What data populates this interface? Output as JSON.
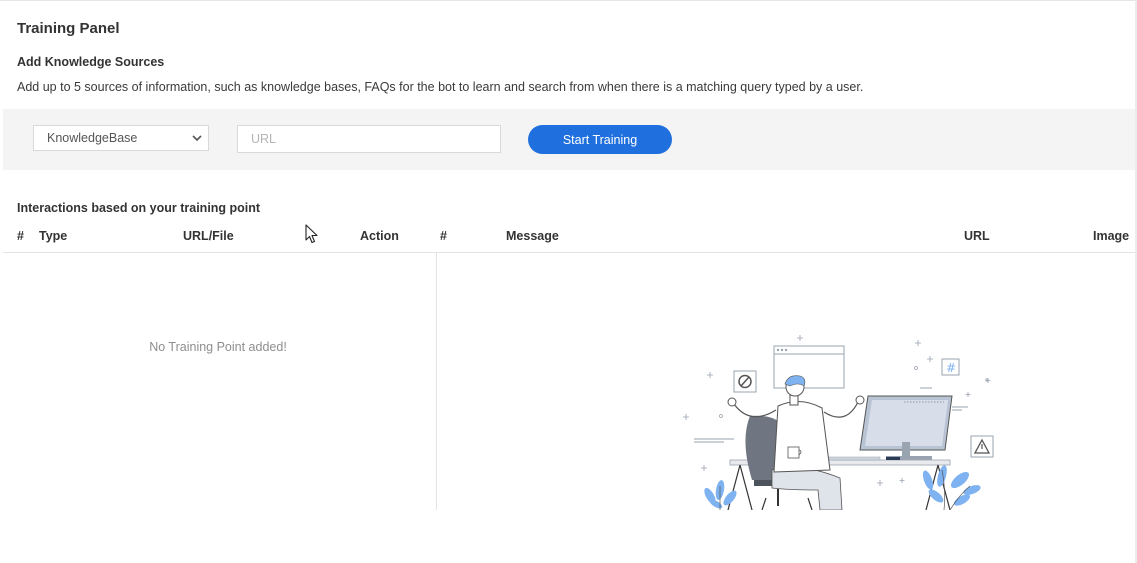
{
  "page": {
    "title": "Training Panel"
  },
  "knowledge_sources": {
    "title": "Add Knowledge Sources",
    "description": "Add up to 5 sources of information, such as knowledge bases, FAQs for the bot to learn and search from when there is a matching query typed by a user.",
    "source_type": {
      "selected": "KnowledgeBase"
    },
    "url_input": {
      "value": "",
      "placeholder": "URL"
    },
    "start_button": "Start Training"
  },
  "interactions": {
    "title": "Interactions based on your training point",
    "training_columns": [
      "#",
      "Type",
      "URL/File",
      "Action"
    ],
    "interaction_columns": [
      "#",
      "Message",
      "URL",
      "Image"
    ],
    "empty_message": "No Training Point added!"
  },
  "colors": {
    "accent": "#1f6fde",
    "illustration_blue": "#7fb2f0",
    "panel_bg": "#f4f4f4"
  },
  "icons": {
    "dropdown": "chevron-down-icon",
    "cursor": "mouse-pointer-icon",
    "illustration": "empty-state-illustration"
  }
}
